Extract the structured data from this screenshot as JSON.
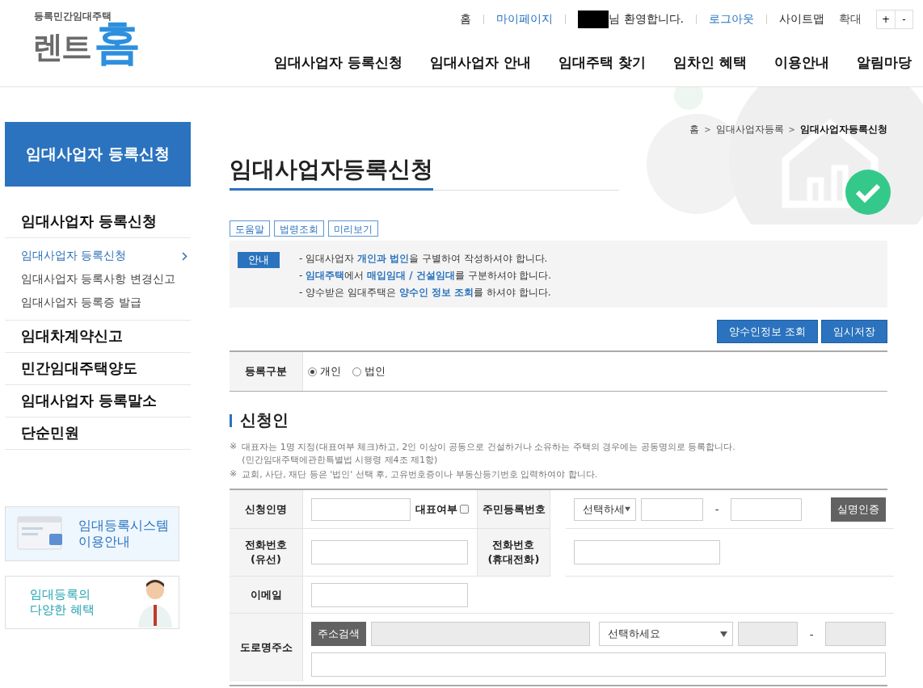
{
  "logo": {
    "subtitle": "등록민간임대주택",
    "name_left": "렌트",
    "name_right": "홈"
  },
  "util_links": [
    {
      "label": "홈",
      "kind": "plain"
    },
    {
      "label": "마이페이지",
      "kind": "link"
    },
    {
      "label": "님 환영합니다.",
      "kind": "user"
    },
    {
      "label": "로그아웃",
      "kind": "link"
    },
    {
      "label": "사이트맵",
      "kind": "plain"
    }
  ],
  "zoom": {
    "label": "확대",
    "buttons": [
      "+",
      "-"
    ]
  },
  "main_nav": [
    "임대사업자 등록신청",
    "임대사업자 안내",
    "임대주택 찾기",
    "임차인 혜택",
    "이용안내",
    "알림마당"
  ],
  "sidebar": {
    "title": "임대사업자 등록신청",
    "groups": [
      {
        "label": "임대사업자 등록신청",
        "children": [
          {
            "label": "임대사업자 등록신청",
            "selected": true
          },
          {
            "label": "임대사업자 등록사항 변경신고",
            "selected": false
          },
          {
            "label": "임대사업자 등록증 발급",
            "selected": false
          }
        ]
      },
      {
        "label": "임대차계약신고"
      },
      {
        "label": "민간임대주택양도"
      },
      {
        "label": "임대사업자 등록말소"
      },
      {
        "label": "단순민원"
      }
    ]
  },
  "banners": [
    {
      "title": "임대등록시스템 이용안내",
      "kind": "guide"
    },
    {
      "title": "임대등록의 다양한 혜택",
      "kind": "benefit"
    }
  ],
  "breadcrumb": [
    {
      "label": "홈"
    },
    {
      "separator": ">",
      "label": "임대사업자등록"
    },
    {
      "separator": ">",
      "label": "임대사업자등록신청"
    }
  ],
  "page_title": "임대사업자등록신청",
  "tool_buttons": [
    "도움말",
    "법령조회",
    "미리보기"
  ],
  "notice": {
    "badge": "안내",
    "lines": [
      "- 임대사업자 **개인과 법인**을 구별하여 작성하셔야 합니다.",
      "- **임대주택**에서 **매입임대 / 건설임대**를 구분하셔야 합니다.",
      "- 양수받은 임대주택은 **양수인 정보 조회**를 하셔야 합니다."
    ]
  },
  "action_buttons": [
    "양수인정보 조회",
    "임시저장"
  ],
  "registration_type": {
    "label": "등록구분",
    "options": [
      {
        "label": "개인",
        "selected": true
      },
      {
        "label": "법인",
        "selected": false
      }
    ]
  },
  "section_title": "신청인",
  "notes": [
    {
      "mark": "※",
      "text": "대표자는 1명 지정(대표여부 체크)하고, 2인 이상이 공동으로 건설하거나 소유하는 주택의 경우에는 공동명의로 등록합니다.",
      "sub": "(민간임대주택에관한특별법 시행령 제4조 제1항)"
    },
    {
      "mark": "※",
      "text": "교회, 사단, 재단 등은 '법인' 선택 후, 고유번호증이나 부동산등기번호 입력하여야 합니다."
    }
  ],
  "form": {
    "applicant_name": {
      "label": "신청인명",
      "representative_label": "대표여부",
      "representative_checked": false
    },
    "resident_number": {
      "label": "주민등록번호",
      "select": "선택하세",
      "separator": "-",
      "button": "실명인증"
    },
    "phone_landline": {
      "label": "전화번호\n(유선)"
    },
    "phone_mobile": {
      "label": "전화번호\n(휴대전화)"
    },
    "email": {
      "label": "이메일"
    },
    "road_address": {
      "label": "도로명주소",
      "button": "주소검색",
      "select": "선택하세요",
      "separator": "-"
    }
  }
}
